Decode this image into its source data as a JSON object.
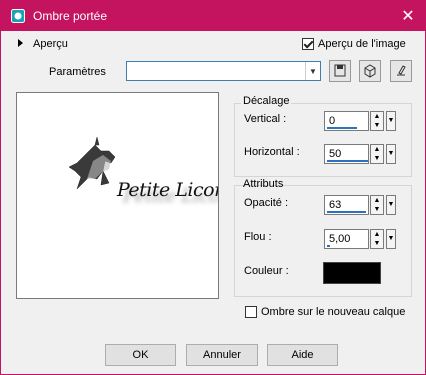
{
  "window": {
    "title": "Ombre portée"
  },
  "apercu": {
    "label": "Aperçu",
    "preview_image_label": "Aperçu de l'image",
    "preview_image_checked": true
  },
  "presets": {
    "label": "Paramètres",
    "value": ""
  },
  "preview": {
    "watermark_text": "Petite Licorne Graphisme"
  },
  "decalage": {
    "title": "Décalage",
    "vertical": {
      "label": "Vertical :",
      "value": "0"
    },
    "horizontal": {
      "label": "Horizontal :",
      "value": "50"
    }
  },
  "attributs": {
    "title": "Attributs",
    "opacite": {
      "label": "Opacité :",
      "value": "63"
    },
    "flou": {
      "label": "Flou :",
      "value": "5,00"
    },
    "couleur": {
      "label": "Couleur :",
      "value": "#000000"
    }
  },
  "shadow_new_layer": {
    "label": "Ombre sur le nouveau calque",
    "checked": false
  },
  "buttons": {
    "ok": "OK",
    "cancel": "Annuler",
    "help": "Aide"
  },
  "colors": {
    "titlebar": "#c5145f",
    "accent": "#2d72bf"
  }
}
